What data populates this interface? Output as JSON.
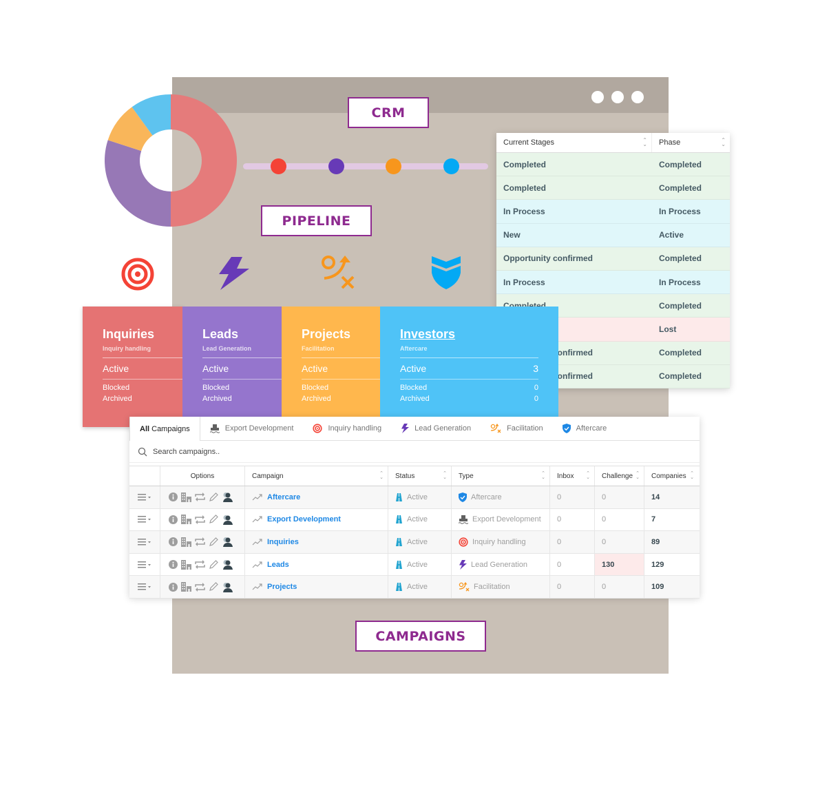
{
  "labels": {
    "crm": "CRM",
    "pipeline": "PIPELINE",
    "campaigns": "CAMPAIGNS"
  },
  "colors": {
    "brand_purple": "#8e2a8f",
    "red": "#f44336",
    "purple": "#673ab7",
    "orange": "#ff9800",
    "blue": "#03a9f4",
    "window_bg": "#c9c0b6",
    "window_bar": "#b1a89f"
  },
  "donut": {
    "segments": [
      {
        "name": "Inquiries",
        "fraction": 0.5,
        "color": "#e57b7b"
      },
      {
        "name": "Leads",
        "fraction": 0.3,
        "color": "#9778b6"
      },
      {
        "name": "Projects",
        "fraction": 0.1,
        "color": "#f9b65a"
      },
      {
        "name": "Investors",
        "fraction": 0.1,
        "color": "#5ec3ef"
      }
    ]
  },
  "pipeline_icons": [
    "target-icon",
    "lightning-icon",
    "strategy-icon",
    "shield-icon"
  ],
  "stages_table": {
    "headers": [
      "Current Stages",
      "Phase"
    ],
    "rows": [
      {
        "stage": "Completed",
        "phase": "Completed",
        "tone": "green"
      },
      {
        "stage": "Completed",
        "phase": "Completed",
        "tone": "green"
      },
      {
        "stage": "In Process",
        "phase": "In Process",
        "tone": "blue"
      },
      {
        "stage": "New",
        "phase": "Active",
        "tone": "blue"
      },
      {
        "stage": "Opportunity confirmed",
        "phase": "Completed",
        "tone": "green"
      },
      {
        "stage": "In Process",
        "phase": "In Process",
        "tone": "blue"
      },
      {
        "stage": "Completed",
        "phase": "Completed",
        "tone": "green"
      },
      {
        "stage": "",
        "phase": "Lost",
        "tone": "red"
      },
      {
        "stage": "Opportunity confirmed",
        "phase": "Completed",
        "tone": "green"
      },
      {
        "stage": "Opportunity confirmed",
        "phase": "Completed",
        "tone": "green"
      }
    ]
  },
  "cards": [
    {
      "title": "Inquiries",
      "subtitle": "Inquiry handling",
      "active_label": "Active",
      "active_count": "",
      "blocked_label": "Blocked",
      "blocked_count": "",
      "archived_label": "Archived",
      "archived_count": ""
    },
    {
      "title": "Leads",
      "subtitle": "Lead Generation",
      "active_label": "Active",
      "active_count": "",
      "blocked_label": "Blocked",
      "blocked_count": "",
      "archived_label": "Archived",
      "archived_count": ""
    },
    {
      "title": "Projects",
      "subtitle": "Facilitation",
      "active_label": "Active",
      "active_count": "",
      "blocked_label": "Blocked",
      "blocked_count": "",
      "archived_label": "Archived",
      "archived_count": ""
    },
    {
      "title": "Investors",
      "subtitle": "Aftercare",
      "active_label": "Active",
      "active_count": "3",
      "blocked_label": "Blocked",
      "blocked_count": "0",
      "archived_label": "Archived",
      "archived_count": "0"
    }
  ],
  "campaigns": {
    "tabs": [
      {
        "bold": "All",
        "label": "Campaigns",
        "icon": "",
        "active": true
      },
      {
        "bold": "",
        "label": "Export Development",
        "icon": "ship-icon"
      },
      {
        "bold": "",
        "label": "Inquiry handling",
        "icon": "target-icon"
      },
      {
        "bold": "",
        "label": "Lead Generation",
        "icon": "lightning-icon"
      },
      {
        "bold": "",
        "label": "Facilitation",
        "icon": "strategy-icon"
      },
      {
        "bold": "",
        "label": "Aftercare",
        "icon": "shield-icon"
      }
    ],
    "search_placeholder": "Search campaigns..",
    "columns": [
      "",
      "Options",
      "Campaign",
      "Status",
      "Type",
      "Inbox",
      "Challenge",
      "Companies"
    ],
    "rows": [
      {
        "campaign": "Aftercare",
        "status": "Active",
        "type": "Aftercare",
        "type_icon": "shield-icon",
        "inbox": "0",
        "challenge": "0",
        "companies": "14",
        "challenge_alert": false
      },
      {
        "campaign": "Export Development",
        "status": "Active",
        "type": "Export Development",
        "type_icon": "ship-icon",
        "inbox": "0",
        "challenge": "0",
        "companies": "7",
        "challenge_alert": false
      },
      {
        "campaign": "Inquiries",
        "status": "Active",
        "type": "Inquiry handling",
        "type_icon": "target-icon",
        "inbox": "0",
        "challenge": "0",
        "companies": "89",
        "challenge_alert": false
      },
      {
        "campaign": "Leads",
        "status": "Active",
        "type": "Lead Generation",
        "type_icon": "lightning-icon",
        "inbox": "0",
        "challenge": "130",
        "companies": "129",
        "challenge_alert": true
      },
      {
        "campaign": "Projects",
        "status": "Active",
        "type": "Facilitation",
        "type_icon": "strategy-icon",
        "inbox": "0",
        "challenge": "0",
        "companies": "109",
        "challenge_alert": false
      }
    ]
  }
}
